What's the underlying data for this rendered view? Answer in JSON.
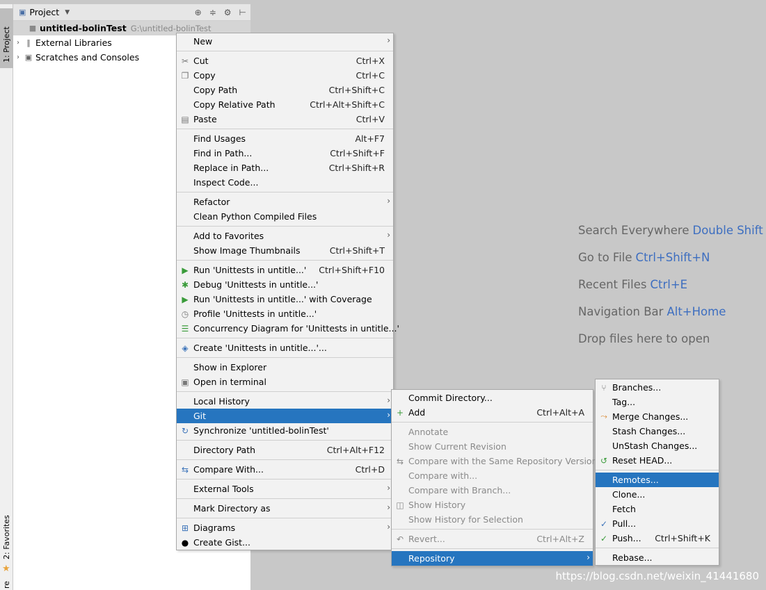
{
  "side_strip": {
    "project_tab": "1: Project",
    "favorites_tab": "2: Favorites",
    "bottom_tab": "re"
  },
  "project_panel": {
    "title": "Project",
    "root": {
      "name": "untitled-bolinTest",
      "path": "G:\\untitled-bolinTest"
    },
    "tree": [
      {
        "label": "External Libraries",
        "icon": "library-icon"
      },
      {
        "label": "Scratches and Consoles",
        "icon": "scratches-icon"
      }
    ]
  },
  "editor_hints": [
    {
      "text": "Search Everywhere",
      "key": "Double Shift"
    },
    {
      "text": "Go to File",
      "key": "Ctrl+Shift+N"
    },
    {
      "text": "Recent Files",
      "key": "Ctrl+E"
    },
    {
      "text": "Navigation Bar",
      "key": "Alt+Home"
    },
    {
      "text": "Drop files here to open",
      "key": ""
    }
  ],
  "watermark": "https://blog.csdn.net/weixin_41441680",
  "context_menu": [
    {
      "label": "New",
      "submenu": true
    },
    {
      "sep": true
    },
    {
      "label": "Cut",
      "shortcut": "Ctrl+X",
      "icon": "cut-icon"
    },
    {
      "label": "Copy",
      "shortcut": "Ctrl+C",
      "icon": "copy-icon"
    },
    {
      "label": "Copy Path",
      "shortcut": "Ctrl+Shift+C"
    },
    {
      "label": "Copy Relative Path",
      "shortcut": "Ctrl+Alt+Shift+C"
    },
    {
      "label": "Paste",
      "shortcut": "Ctrl+V",
      "icon": "paste-icon"
    },
    {
      "sep": true
    },
    {
      "label": "Find Usages",
      "shortcut": "Alt+F7"
    },
    {
      "label": "Find in Path...",
      "shortcut": "Ctrl+Shift+F"
    },
    {
      "label": "Replace in Path...",
      "shortcut": "Ctrl+Shift+R"
    },
    {
      "label": "Inspect Code..."
    },
    {
      "sep": true
    },
    {
      "label": "Refactor",
      "submenu": true
    },
    {
      "label": "Clean Python Compiled Files"
    },
    {
      "sep": true
    },
    {
      "label": "Add to Favorites",
      "submenu": true
    },
    {
      "label": "Show Image Thumbnails",
      "shortcut": "Ctrl+Shift+T"
    },
    {
      "sep": true
    },
    {
      "label": "Run 'Unittests in untitle...'",
      "shortcut": "Ctrl+Shift+F10",
      "icon": "run-icon"
    },
    {
      "label": "Debug 'Unittests in untitle...'",
      "icon": "debug-icon"
    },
    {
      "label": "Run 'Unittests in untitle...' with Coverage",
      "icon": "coverage-icon"
    },
    {
      "label": "Profile 'Unittests in untitle...'",
      "icon": "profile-icon"
    },
    {
      "label": "Concurrency Diagram for 'Unittests in untitle...'",
      "icon": "concurrency-icon"
    },
    {
      "sep": true
    },
    {
      "label": "Create 'Unittests in untitle...'...",
      "icon": "python-icon"
    },
    {
      "sep": true
    },
    {
      "label": "Show in Explorer"
    },
    {
      "label": "Open in terminal",
      "icon": "terminal-icon"
    },
    {
      "sep": true
    },
    {
      "label": "Local History",
      "submenu": true
    },
    {
      "label": "Git",
      "submenu": true,
      "highlight": true
    },
    {
      "label": "Synchronize 'untitled-bolinTest'",
      "icon": "sync-icon"
    },
    {
      "sep": true
    },
    {
      "label": "Directory Path",
      "shortcut": "Ctrl+Alt+F12"
    },
    {
      "sep": true
    },
    {
      "label": "Compare With...",
      "shortcut": "Ctrl+D",
      "icon": "compare-icon"
    },
    {
      "sep": true
    },
    {
      "label": "External Tools",
      "submenu": true
    },
    {
      "sep": true
    },
    {
      "label": "Mark Directory as",
      "submenu": true
    },
    {
      "sep": true
    },
    {
      "label": "Diagrams",
      "submenu": true,
      "icon": "diagram-icon"
    },
    {
      "label": "Create Gist...",
      "icon": "github-icon"
    }
  ],
  "git_menu": [
    {
      "label": "Commit Directory..."
    },
    {
      "label": "Add",
      "shortcut": "Ctrl+Alt+A",
      "icon": "add-icon"
    },
    {
      "sep": true
    },
    {
      "label": "Annotate",
      "disabled": true
    },
    {
      "label": "Show Current Revision",
      "disabled": true
    },
    {
      "label": "Compare with the Same Repository Version",
      "disabled": true,
      "icon": "compare-icon"
    },
    {
      "label": "Compare with...",
      "disabled": true
    },
    {
      "label": "Compare with Branch...",
      "disabled": true
    },
    {
      "label": "Show History",
      "disabled": true,
      "icon": "history-icon"
    },
    {
      "label": "Show History for Selection",
      "disabled": true
    },
    {
      "sep": true
    },
    {
      "label": "Revert...",
      "shortcut": "Ctrl+Alt+Z",
      "disabled": true,
      "icon": "revert-icon"
    },
    {
      "sep": true
    },
    {
      "label": "Repository",
      "submenu": true,
      "highlight": true
    }
  ],
  "repo_menu": [
    {
      "label": "Branches...",
      "icon": "branch-icon"
    },
    {
      "label": "Tag..."
    },
    {
      "label": "Merge Changes...",
      "icon": "merge-icon"
    },
    {
      "label": "Stash Changes..."
    },
    {
      "label": "UnStash Changes..."
    },
    {
      "label": "Reset HEAD...",
      "icon": "reset-icon"
    },
    {
      "sep": true
    },
    {
      "label": "Remotes...",
      "highlight": true
    },
    {
      "label": "Clone..."
    },
    {
      "label": "Fetch"
    },
    {
      "label": "Pull...",
      "icon": "pull-icon"
    },
    {
      "label": "Push...",
      "shortcut": "Ctrl+Shift+K",
      "icon": "push-icon"
    },
    {
      "sep": true
    },
    {
      "label": "Rebase..."
    }
  ]
}
